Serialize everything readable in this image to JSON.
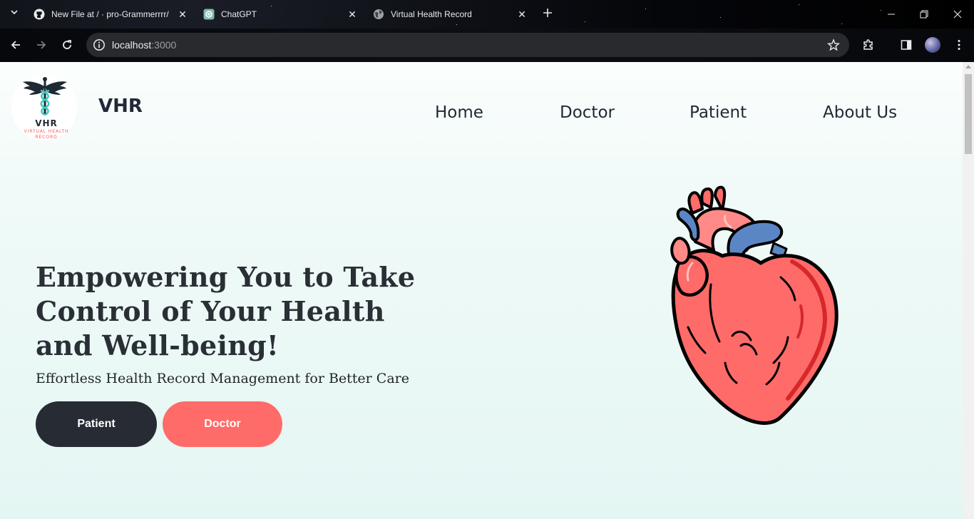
{
  "browser": {
    "tabs": [
      {
        "title": "New File at / · pro-Grammerrrr/",
        "icon": "github-icon",
        "active": false
      },
      {
        "title": "ChatGPT",
        "icon": "chatgpt-icon",
        "active": false
      },
      {
        "title": "Virtual Health Record",
        "icon": "globe-icon",
        "active": true
      }
    ],
    "url_host": "localhost",
    "url_port": ":3000"
  },
  "site": {
    "brand": "VHR",
    "logo": {
      "line1": "VHR",
      "line2": "VIRTUAL HEALTH",
      "line3": "RECORD"
    },
    "nav": [
      "Home",
      "Doctor",
      "Patient",
      "About Us"
    ],
    "hero": {
      "title": "Empowering You to Take Control of Your Health and Well-being!",
      "subtitle": "Effortless Health Record Management for Better Care",
      "buttons": {
        "patient": "Patient",
        "doctor": "Doctor"
      }
    },
    "colors": {
      "dark": "#272b33",
      "coral": "#ff6b69",
      "teal": "#3ec8c0"
    }
  }
}
